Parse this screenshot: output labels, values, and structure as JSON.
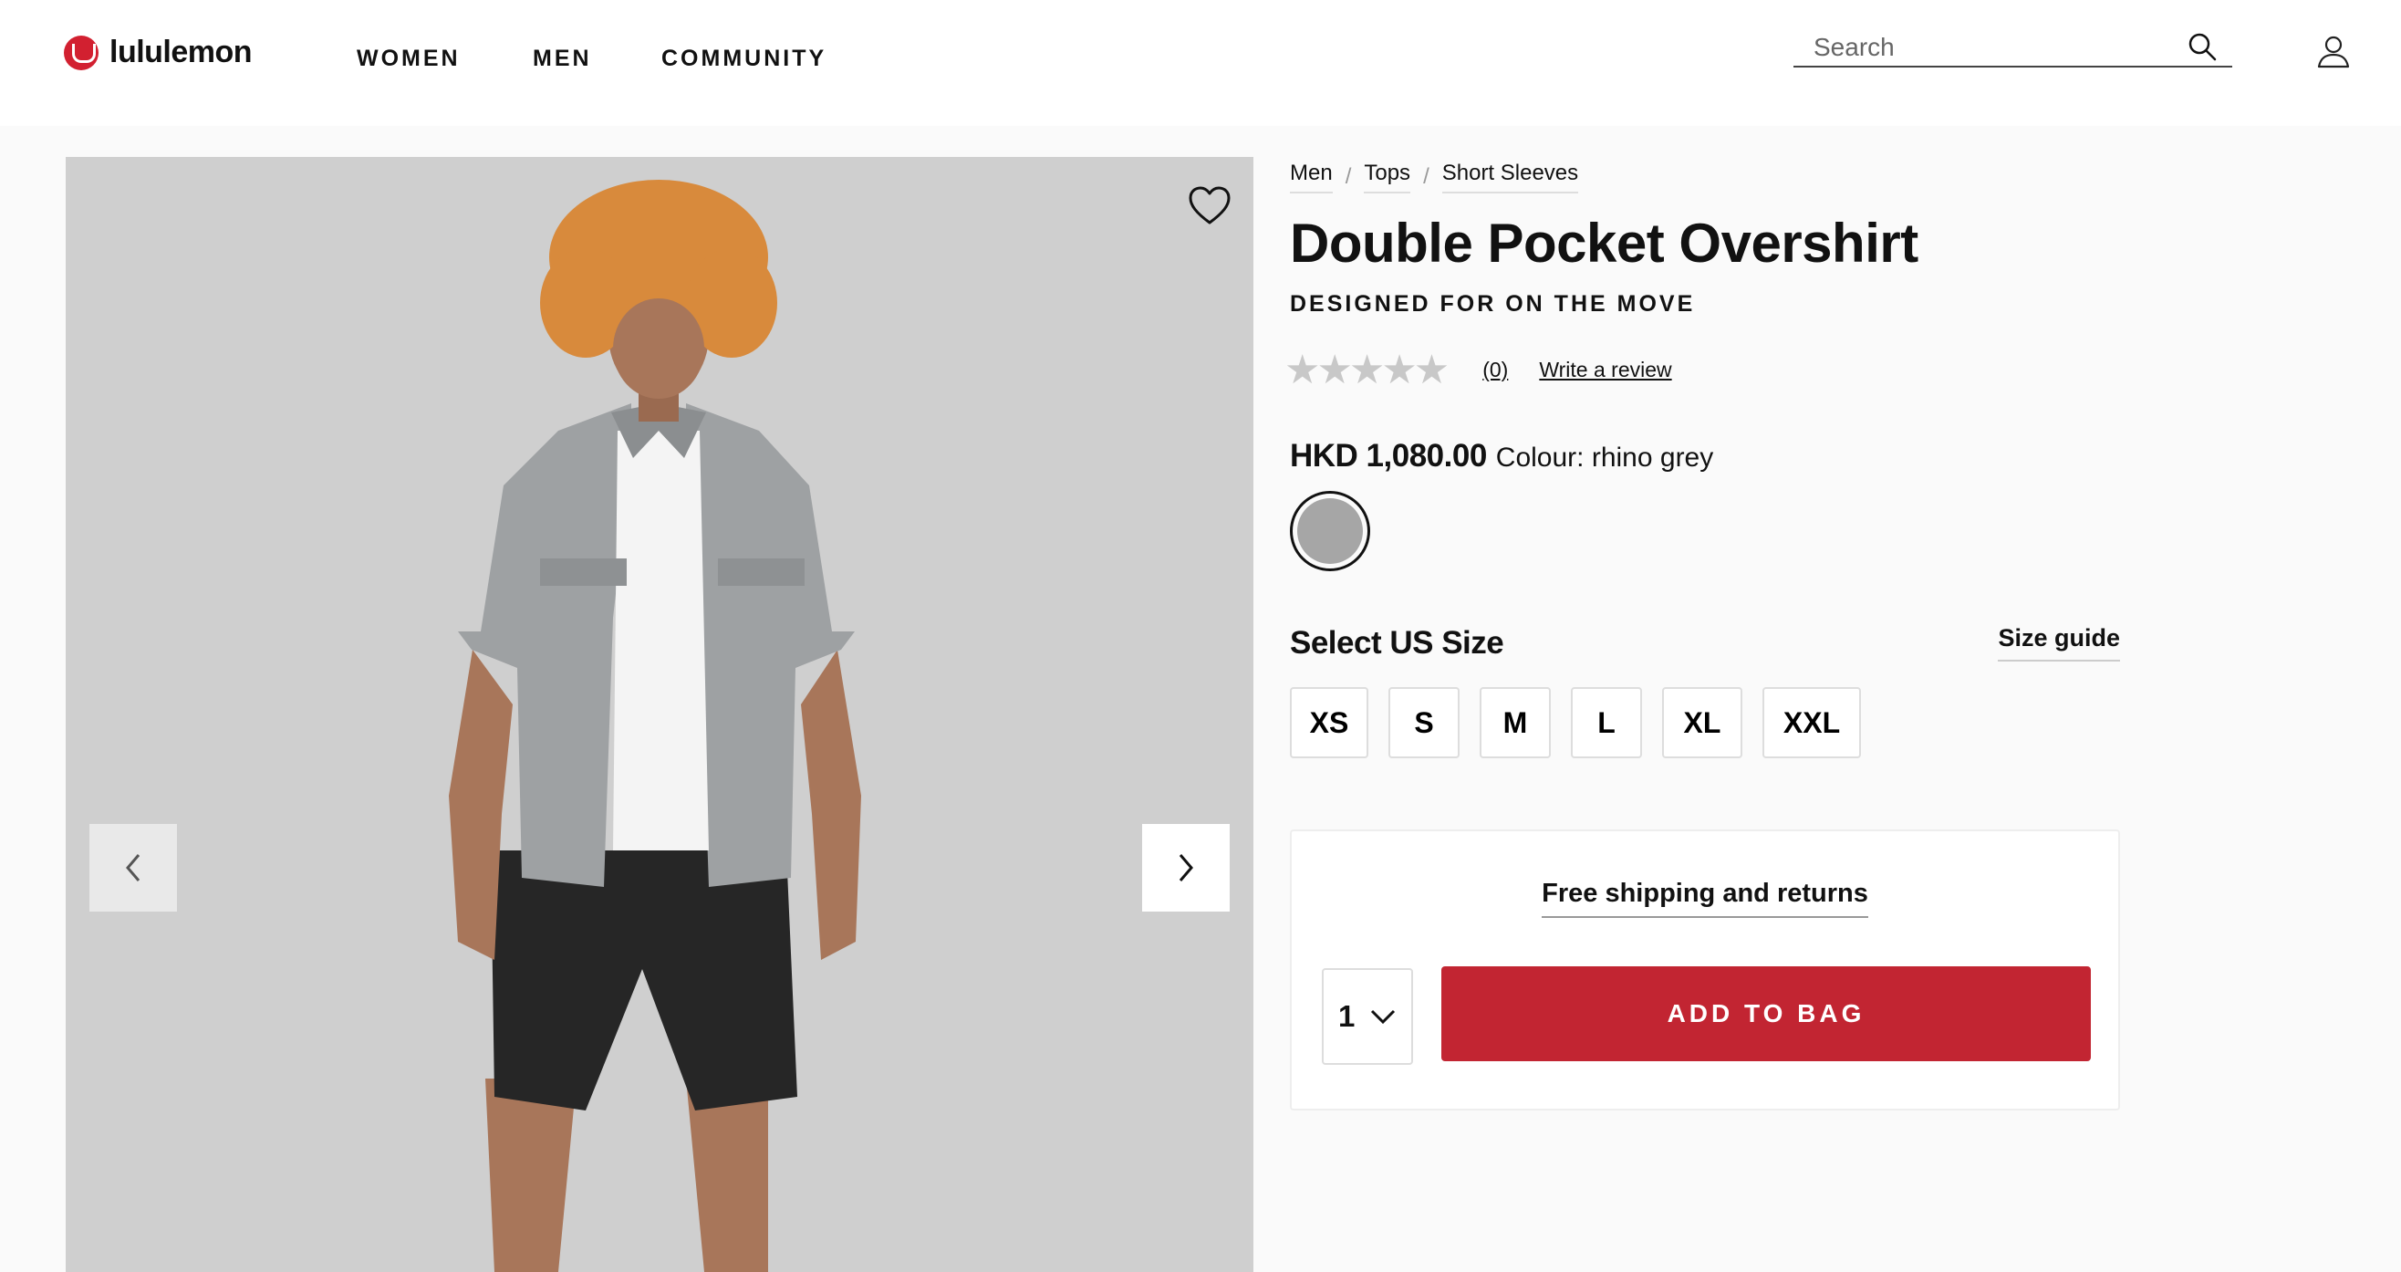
{
  "brand": {
    "name": "lululemon",
    "logo_color": "#d22030"
  },
  "nav": [
    {
      "label": "WOMEN"
    },
    {
      "label": "MEN"
    },
    {
      "label": "COMMUNITY"
    }
  ],
  "search": {
    "placeholder": "Search",
    "icon": "search-icon"
  },
  "account": {
    "icon": "user-icon"
  },
  "gallery": {
    "favorite_icon": "heart-icon",
    "prev_icon": "chevron-left-icon",
    "next_icon": "chevron-right-icon",
    "background": "#cfcfcf"
  },
  "breadcrumb": [
    {
      "label": "Men"
    },
    {
      "label": "Tops"
    },
    {
      "label": "Short Sleeves"
    }
  ],
  "breadcrumb_separator": "/",
  "product": {
    "title": "Double Pocket Overshirt",
    "tagline": "DESIGNED FOR ON THE MOVE",
    "rating": {
      "stars_display": "★★★★★",
      "stars_filled": 0,
      "review_count": "(0)",
      "write_review": "Write a review"
    },
    "price": "HKD 1,080.00",
    "colour_label": "Colour: rhino grey",
    "swatch_color": "#a6a6a6"
  },
  "size": {
    "title": "Select US Size",
    "guide": "Size guide",
    "options": [
      {
        "label": "XS"
      },
      {
        "label": "S"
      },
      {
        "label": "M"
      },
      {
        "label": "L"
      },
      {
        "label": "XL"
      },
      {
        "label": "XXL"
      }
    ]
  },
  "purchase": {
    "shipping": "Free shipping and returns",
    "quantity": "1",
    "add_to_bag": "ADD TO BAG",
    "button_color": "#c22532"
  }
}
